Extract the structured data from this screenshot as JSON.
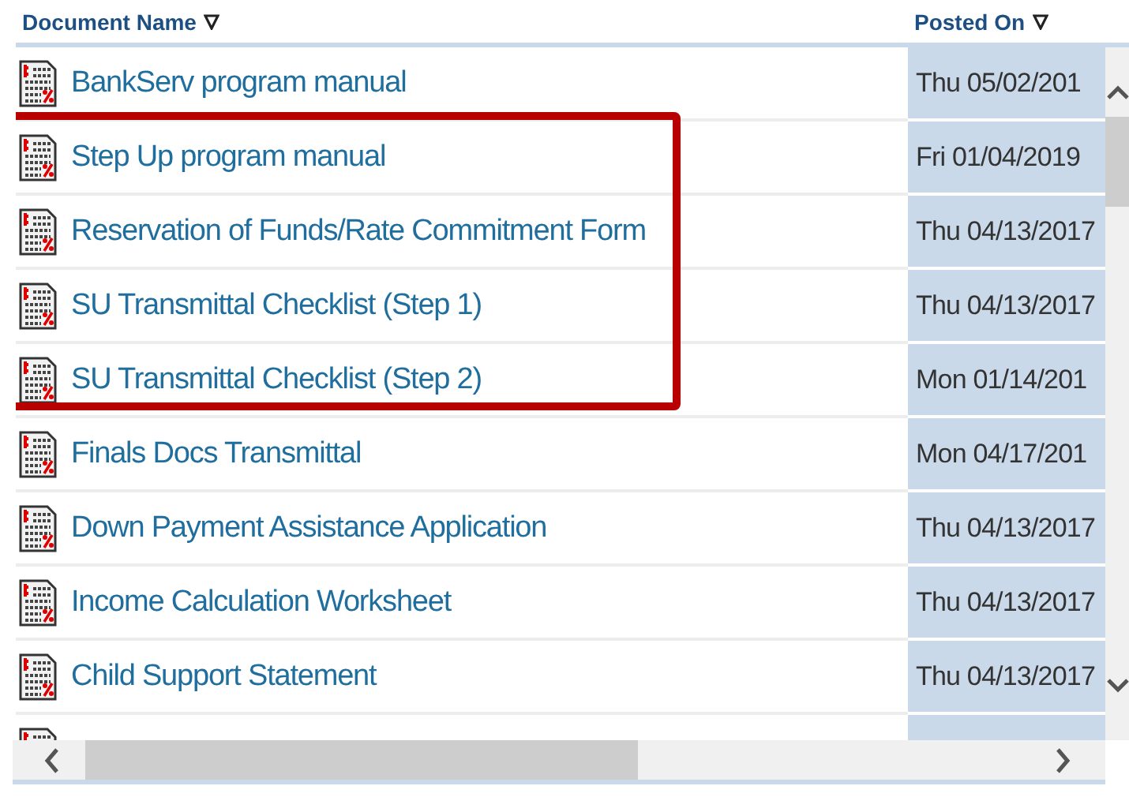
{
  "table": {
    "columns": [
      {
        "label": "Document Name"
      },
      {
        "label": "Posted On"
      }
    ],
    "rows": [
      {
        "name": "BankServ program manual",
        "posted": "Thu 05/02/201",
        "highlighted": false
      },
      {
        "name": "Step Up program manual",
        "posted": "Fri 01/04/2019",
        "highlighted": true
      },
      {
        "name": "Reservation of Funds/Rate Commitment Form",
        "posted": "Thu 04/13/2017",
        "highlighted": true
      },
      {
        "name": "SU Transmittal Checklist (Step 1)",
        "posted": "Thu 04/13/2017",
        "highlighted": true
      },
      {
        "name": "SU Transmittal Checklist (Step 2)",
        "posted": "Mon 01/14/201",
        "highlighted": true
      },
      {
        "name": "Finals Docs Transmittal",
        "posted": "Mon 04/17/201",
        "highlighted": false
      },
      {
        "name": "Down Payment Assistance Application",
        "posted": "Thu 04/13/2017",
        "highlighted": false
      },
      {
        "name": "Income Calculation Worksheet",
        "posted": "Thu 04/13/2017",
        "highlighted": false
      },
      {
        "name": "Child Support Statement",
        "posted": "Thu 04/13/2017",
        "highlighted": false
      },
      {
        "highlighted": false
      }
    ]
  }
}
